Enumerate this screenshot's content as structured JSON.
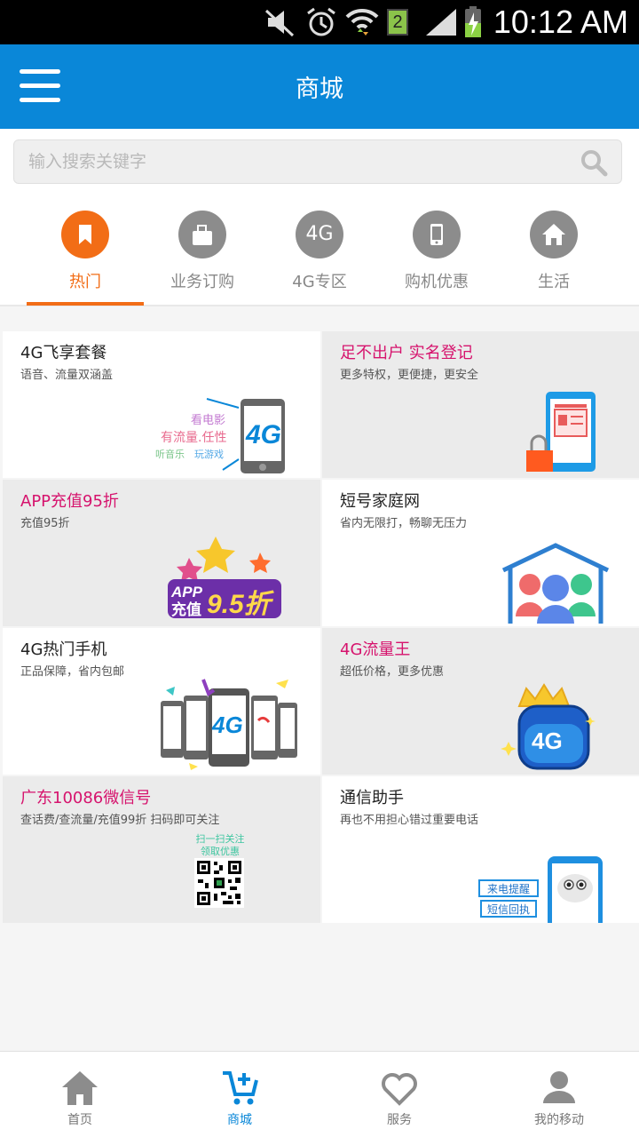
{
  "status_bar": {
    "time": "10:12 AM",
    "sim_badge": "2"
  },
  "header": {
    "title": "商城"
  },
  "search": {
    "placeholder": "输入搜索关键字"
  },
  "tabs": [
    {
      "label": "热门",
      "icon": "bookmark-icon",
      "active": true
    },
    {
      "label": "业务订购",
      "icon": "cards-icon"
    },
    {
      "label": "4G专区",
      "icon_text": "4G"
    },
    {
      "label": "购机优惠",
      "icon": "phone-icon"
    },
    {
      "label": "生活",
      "icon": "home-icon"
    }
  ],
  "cards": [
    {
      "title": "4G飞享套餐",
      "subtitle": "语音、流量双涵盖",
      "art_text": [
        "看电影",
        "有流量.任性",
        "听音乐",
        "玩游戏",
        "4G"
      ]
    },
    {
      "title": "足不出户 实名登记",
      "subtitle": "更多特权，更便捷，更安全"
    },
    {
      "title": "APP充值95折",
      "subtitle": "充值95折",
      "art_text": [
        "APP",
        "充值",
        "9.5折"
      ]
    },
    {
      "title": "短号家庭网",
      "subtitle": "省内无限打，畅聊无压力"
    },
    {
      "title": "4G热门手机",
      "subtitle": "正品保障，省内包邮",
      "art_text": [
        "4G"
      ]
    },
    {
      "title": "4G流量王",
      "subtitle": "超低价格，更多优惠",
      "art_text": [
        "4G"
      ]
    },
    {
      "title": "广东10086微信号",
      "subtitle": "查话费/查流量/充值99折 扫码即可关注",
      "art_text": [
        "扫一扫关注",
        "领取优惠"
      ]
    },
    {
      "title": "通信助手",
      "subtitle": "再也不用担心错过重要电话",
      "art_text": [
        "来电提醒",
        "短信回执"
      ]
    }
  ],
  "bottom_nav": [
    {
      "label": "首页"
    },
    {
      "label": "商城",
      "active": true
    },
    {
      "label": "服务"
    },
    {
      "label": "我的移动"
    }
  ],
  "colors": {
    "brand_blue": "#0a87d8",
    "accent_orange": "#f26d16",
    "pink_title": "#d6136d"
  }
}
